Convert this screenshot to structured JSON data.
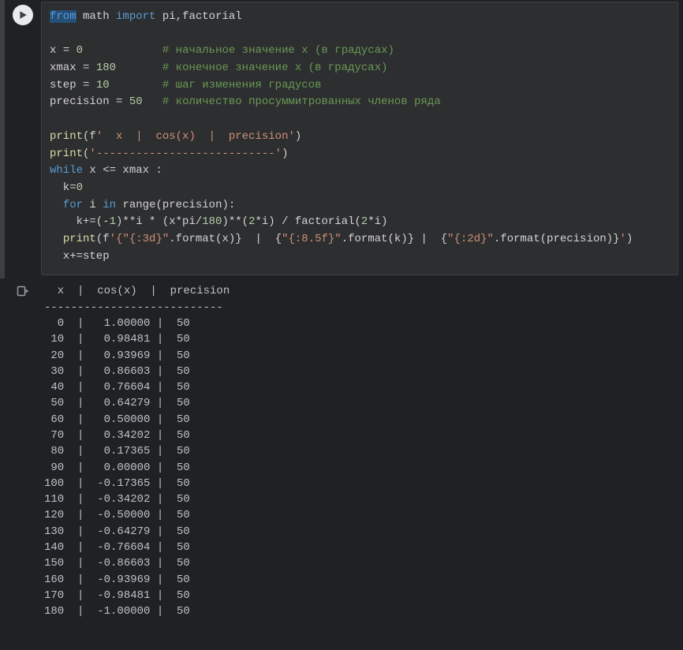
{
  "code": {
    "l1": {
      "kw1": "from",
      "mod": "math",
      "kw2": "import",
      "names": "pi,factorial"
    },
    "l3": {
      "var": "x",
      "eq": "=",
      "val": "0",
      "cmt": "# начальное значение x (в градусах)"
    },
    "l4": {
      "var": "xmax",
      "eq": "=",
      "val": "180",
      "cmt": "# конечное значение x (в градусах)"
    },
    "l5": {
      "var": "step",
      "eq": "=",
      "val": "10",
      "cmt": "# шаг изменения градусов"
    },
    "l6": {
      "var": "precision",
      "eq": "=",
      "val": "50",
      "cmt": "# количество просуммитрованных членов ряда"
    },
    "l8": {
      "fn": "print",
      "args_open": "(f",
      "str": "'  x  |  cos(x)  |  precision'",
      "close": ")"
    },
    "l9": {
      "fn": "print",
      "open": "(",
      "str": "'---------------------------'",
      "close": ")"
    },
    "l10": {
      "kw": "while",
      "cond": " x <= xmax :"
    },
    "l11": {
      "body": "  k=",
      "num": "0"
    },
    "l12": {
      "kw": "for",
      "mid": " i ",
      "kw2": "in",
      "rest": " range(precision):"
    },
    "l13": {
      "pre": "    k+=(-",
      "n1": "1",
      "mid1": ")**i * (x*pi/",
      "n2": "180",
      "mid2": ")**(",
      "n3": "2",
      "mid3": "*i) / factorial(",
      "n4": "2",
      "mid4": "*i)"
    },
    "l14": {
      "fn": "print",
      "open": "(f",
      "s1": "'{",
      "s1b": "\"{:3d}\"",
      "m1": ".format(x)}  |  {",
      "s2": "\"{:8.5f}\"",
      "m2": ".format(k)} |  {",
      "s3": "\"{:2d}\"",
      "m3": ".format(precision)}",
      "s4": "'",
      "close": ")"
    },
    "l15": {
      "body": "  x+=step"
    }
  },
  "output": {
    "header": "  x  |  cos(x)  |  precision",
    "divider": "---------------------------",
    "rows": [
      {
        "x": "  0",
        "cos": " 1.00000",
        "p": "50"
      },
      {
        "x": " 10",
        "cos": " 0.98481",
        "p": "50"
      },
      {
        "x": " 20",
        "cos": " 0.93969",
        "p": "50"
      },
      {
        "x": " 30",
        "cos": " 0.86603",
        "p": "50"
      },
      {
        "x": " 40",
        "cos": " 0.76604",
        "p": "50"
      },
      {
        "x": " 50",
        "cos": " 0.64279",
        "p": "50"
      },
      {
        "x": " 60",
        "cos": " 0.50000",
        "p": "50"
      },
      {
        "x": " 70",
        "cos": " 0.34202",
        "p": "50"
      },
      {
        "x": " 80",
        "cos": " 0.17365",
        "p": "50"
      },
      {
        "x": " 90",
        "cos": " 0.00000",
        "p": "50"
      },
      {
        "x": "100",
        "cos": "-0.17365",
        "p": "50"
      },
      {
        "x": "110",
        "cos": "-0.34202",
        "p": "50"
      },
      {
        "x": "120",
        "cos": "-0.50000",
        "p": "50"
      },
      {
        "x": "130",
        "cos": "-0.64279",
        "p": "50"
      },
      {
        "x": "140",
        "cos": "-0.76604",
        "p": "50"
      },
      {
        "x": "150",
        "cos": "-0.86603",
        "p": "50"
      },
      {
        "x": "160",
        "cos": "-0.93969",
        "p": "50"
      },
      {
        "x": "170",
        "cos": "-0.98481",
        "p": "50"
      },
      {
        "x": "180",
        "cos": "-1.00000",
        "p": "50"
      }
    ]
  }
}
